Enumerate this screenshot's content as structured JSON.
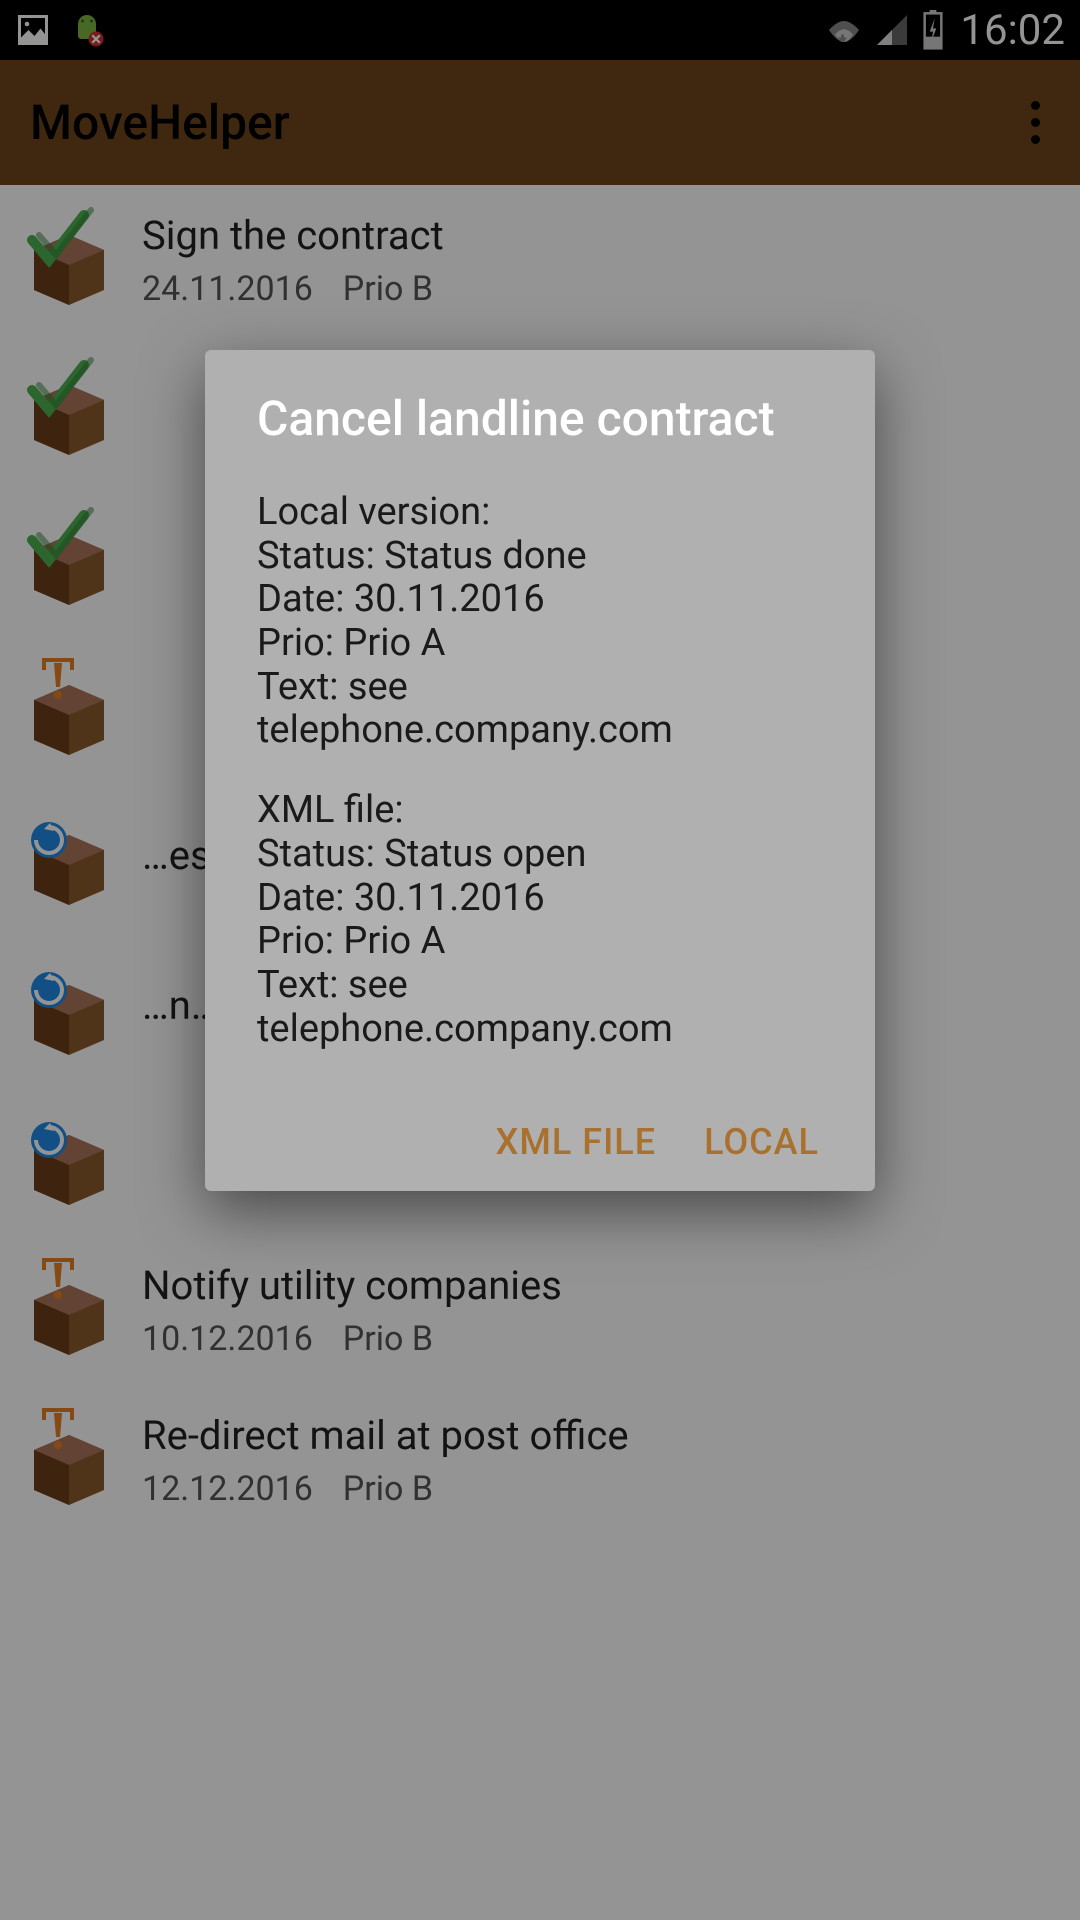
{
  "status_bar": {
    "time": "16:02"
  },
  "app": {
    "title": "MoveHelper"
  },
  "tasks": [
    {
      "icon": "done",
      "title": "Sign the contract",
      "date": "24.11.2016",
      "prio": "Prio B"
    },
    {
      "icon": "done",
      "title": "",
      "date": "",
      "prio": ""
    },
    {
      "icon": "done",
      "title": "",
      "date": "",
      "prio": ""
    },
    {
      "icon": "pending",
      "title": "",
      "date": "",
      "prio": ""
    },
    {
      "icon": "sync",
      "title": "…es",
      "date": "",
      "prio": ""
    },
    {
      "icon": "sync",
      "title": "…n…",
      "date": "",
      "prio": ""
    },
    {
      "icon": "sync",
      "title": "",
      "date": "",
      "prio": ""
    },
    {
      "icon": "pending",
      "title": "Notify utility companies",
      "date": "10.12.2016",
      "prio": "Prio B"
    },
    {
      "icon": "pending",
      "title": "Re-direct mail at post office",
      "date": "12.12.2016",
      "prio": "Prio B"
    }
  ],
  "dialog": {
    "title": "Cancel landline contract",
    "local": {
      "header": "Local version:",
      "status": "Status: Status done",
      "date": "Date: 30.11.2016",
      "prio": "Prio: Prio A",
      "text": "Text: see telephone.company.com"
    },
    "xml": {
      "header": "XML file:",
      "status": "Status: Status open",
      "date": "Date: 30.11.2016",
      "prio": "Prio: Prio A",
      "text": "Text: see telephone.company.com"
    },
    "actions": {
      "xml_file": "XML FILE",
      "local": "LOCAL"
    }
  }
}
